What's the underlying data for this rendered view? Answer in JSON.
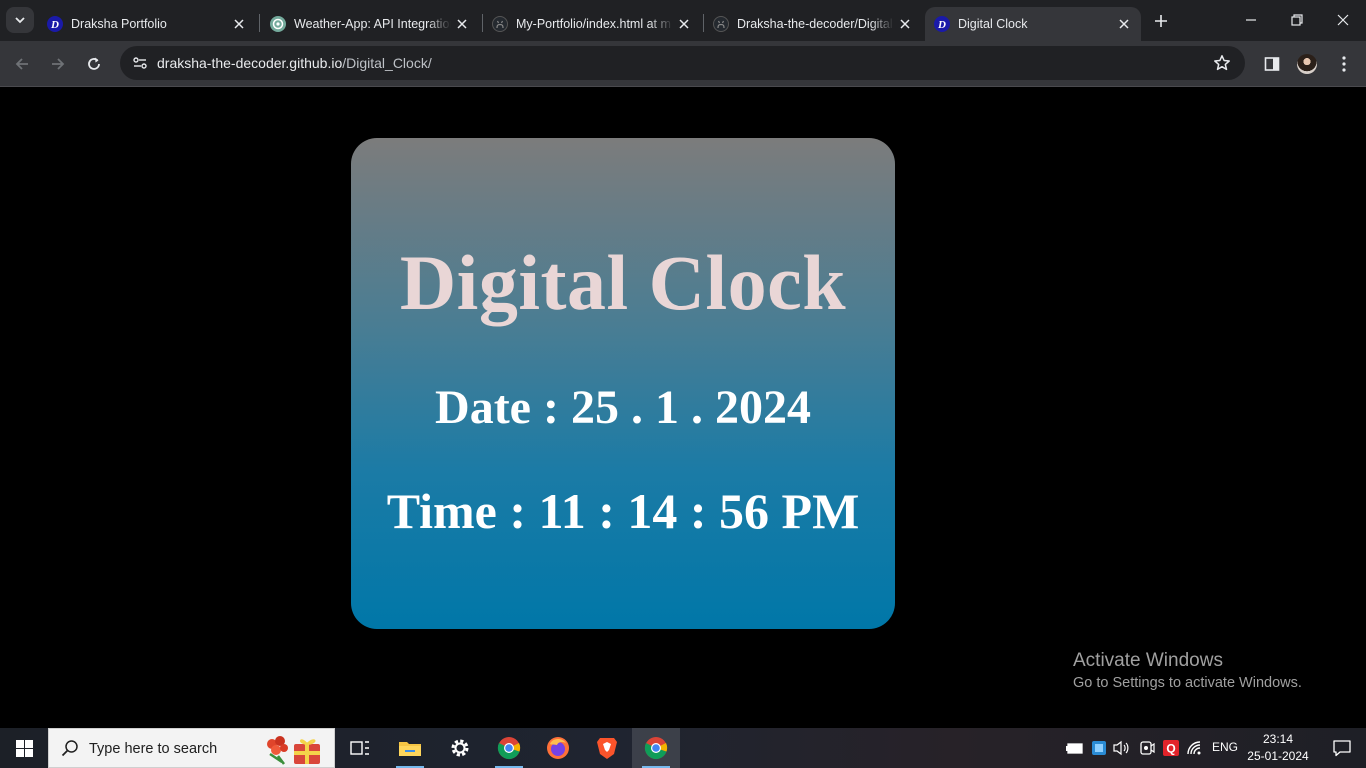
{
  "browser": {
    "tabs": [
      {
        "title": "Draksha Portfolio",
        "icon": "draksha-d-icon",
        "active": false
      },
      {
        "title": "Weather-App: API Integration",
        "icon": "openai-icon",
        "active": false
      },
      {
        "title": "My-Portfolio/index.html at m",
        "icon": "github-icon",
        "active": false
      },
      {
        "title": "Draksha-the-decoder/Digital",
        "icon": "github-icon",
        "active": false
      },
      {
        "title": "Digital Clock",
        "icon": "draksha-d-icon",
        "active": true
      }
    ],
    "url_host": "draksha-the-decoder.github.io",
    "url_path": "/Digital_Clock/"
  },
  "clock": {
    "title": "Digital Clock",
    "date": "Date : 25 . 1 . 2024",
    "time": "Time : 11 : 14 : 56 PM"
  },
  "watermark": {
    "line1": "Activate Windows",
    "line2": "Go to Settings to activate Windows."
  },
  "taskbar": {
    "search_placeholder": "Type here to search",
    "apps": [
      "task-view",
      "file-explorer",
      "settings",
      "chrome",
      "firefox",
      "brave",
      "chrome"
    ],
    "language": "ENG",
    "time": "23:14",
    "date": "25-01-2024"
  },
  "colors": {
    "card_top": "#7c7c7c",
    "card_bottom": "#0077a8",
    "title_text": "#e9d6d6"
  }
}
